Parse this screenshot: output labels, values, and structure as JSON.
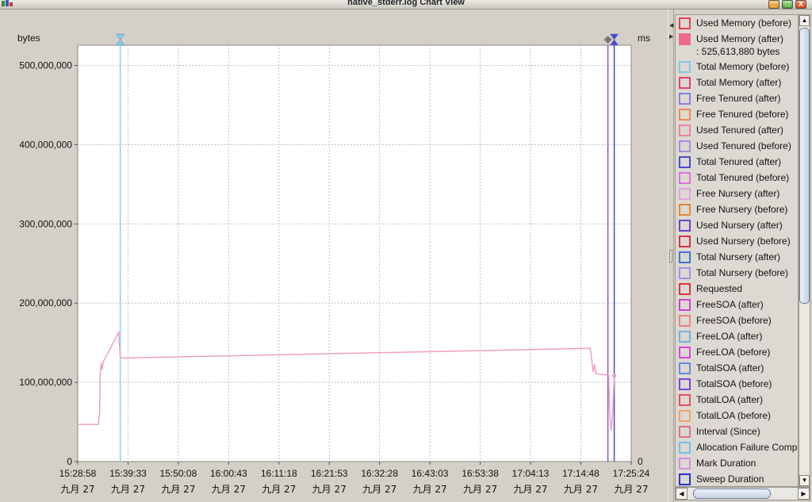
{
  "window": {
    "title": "native_stderr.log Chart View",
    "min_symbol": "_",
    "max_symbol": "□",
    "close_symbol": "X"
  },
  "colors": {
    "series_pink": "#f0a0c0",
    "marker_cyan": "#80d4ec",
    "marker_purple": "#9a50c8",
    "marker_blue": "#4a4ad0",
    "grid": "#c0c0c0",
    "plot_bg": "#ffffff"
  },
  "chart_data": {
    "type": "line",
    "title": "",
    "ylabel": "bytes",
    "y2label": "ms",
    "ylim": [
      0,
      525613880
    ],
    "y_ticks": [
      0,
      100000000,
      200000000,
      300000000,
      400000000,
      500000000
    ],
    "y_tick_labels": [
      "0",
      "100,000,000",
      "200,000,000",
      "300,000,000",
      "400,000,000",
      "500,000,000"
    ],
    "y2_tick_labels": [
      "0"
    ],
    "x_ticks": [
      {
        "time": "15:28:58",
        "date": "九月 27"
      },
      {
        "time": "15:39:33",
        "date": "九月 27"
      },
      {
        "time": "15:50:08",
        "date": "九月 27"
      },
      {
        "time": "16:00:43",
        "date": "九月 27"
      },
      {
        "time": "16:11:18",
        "date": "九月 27"
      },
      {
        "time": "16:21:53",
        "date": "九月 27"
      },
      {
        "time": "16:32:28",
        "date": "九月 27"
      },
      {
        "time": "16:43:03",
        "date": "九月 27"
      },
      {
        "time": "16:53:38",
        "date": "九月 27"
      },
      {
        "time": "17:04:13",
        "date": "九月 27"
      },
      {
        "time": "17:14:48",
        "date": "九月 27"
      },
      {
        "time": "17:25:24",
        "date": "九月 27"
      }
    ],
    "xlim": [
      "15:28:58",
      "17:25:24"
    ],
    "grid": true,
    "legend_position": "right",
    "series": [
      {
        "name": "Used Memory (after)",
        "color": "#f0a0c0",
        "points": [
          [
            "15:28:58",
            47000000
          ],
          [
            "15:33:20",
            47000000
          ],
          [
            "15:33:25",
            55000000
          ],
          [
            "15:33:35",
            61000000
          ],
          [
            "15:33:40",
            110000000
          ],
          [
            "15:33:55",
            124000000
          ],
          [
            "15:34:05",
            116000000
          ],
          [
            "15:34:20",
            126000000
          ],
          [
            "15:37:35",
            163000000
          ],
          [
            "15:37:55",
            131000000
          ],
          [
            "15:40:30",
            131000000
          ],
          [
            "17:16:48",
            143000000
          ],
          [
            "17:17:25",
            113000000
          ],
          [
            "17:17:40",
            123000000
          ],
          [
            "17:18:00",
            111000000
          ],
          [
            "17:20:40",
            109000000
          ],
          [
            "17:20:50",
            70000000
          ],
          [
            "17:21:10",
            39000000
          ],
          [
            "17:21:30",
            60000000
          ],
          [
            "17:21:50",
            108000000
          ]
        ]
      }
    ],
    "markers": [
      {
        "time": "15:37:55",
        "color": "#80d4ec",
        "icon": "hourglass-icon"
      },
      {
        "time": "17:20:30",
        "color": "#9a50c8",
        "icon": "diamond-icon"
      },
      {
        "time": "17:21:50",
        "color": "#4a4ad0",
        "icon": "hourglass-icon"
      }
    ]
  },
  "legend": {
    "items": [
      {
        "label": "Used Memory (before)",
        "color": "#e04050",
        "filled": false
      },
      {
        "label": "Used Memory (after)",
        "color": "#f06a90",
        "filled": true,
        "value": ": 525,613,880 bytes"
      },
      {
        "label": "Total Memory (before)",
        "color": "#80c8e8",
        "filled": false
      },
      {
        "label": "Total Memory (after)",
        "color": "#e04070",
        "filled": false
      },
      {
        "label": "Free Tenured (after)",
        "color": "#8a7ee0",
        "filled": false
      },
      {
        "label": "Free Tenured (before)",
        "color": "#f08a50",
        "filled": false
      },
      {
        "label": "Used Tenured (after)",
        "color": "#f080a0",
        "filled": false
      },
      {
        "label": "Used Tenured (before)",
        "color": "#a888e0",
        "filled": false
      },
      {
        "label": "Total Tenured (after)",
        "color": "#4a4ad0",
        "filled": false
      },
      {
        "label": "Total Tenured (before)",
        "color": "#e070e0",
        "filled": false
      },
      {
        "label": "Free Nursery (after)",
        "color": "#e0a0e0",
        "filled": false
      },
      {
        "label": "Free Nursery (before)",
        "color": "#e08838",
        "filled": false
      },
      {
        "label": "Used Nursery (after)",
        "color": "#7040d0",
        "filled": false
      },
      {
        "label": "Used Nursery (before)",
        "color": "#d83048",
        "filled": false
      },
      {
        "label": "Total Nursery (after)",
        "color": "#4070e0",
        "filled": false
      },
      {
        "label": "Total Nursery (before)",
        "color": "#a090e8",
        "filled": false
      },
      {
        "label": "Requested",
        "color": "#e03040",
        "filled": false
      },
      {
        "label": "FreeSOA (after)",
        "color": "#d040d0",
        "filled": false
      },
      {
        "label": "FreeSOA (before)",
        "color": "#f08080",
        "filled": false
      },
      {
        "label": "FreeLOA (after)",
        "color": "#70b0e0",
        "filled": false
      },
      {
        "label": "FreeLOA (before)",
        "color": "#e040e0",
        "filled": false
      },
      {
        "label": "TotalSOA (after)",
        "color": "#6090e0",
        "filled": false
      },
      {
        "label": "TotalSOA (before)",
        "color": "#8040e0",
        "filled": false
      },
      {
        "label": "TotalLOA (after)",
        "color": "#e05060",
        "filled": false
      },
      {
        "label": "TotalLOA (before)",
        "color": "#f0a070",
        "filled": false
      },
      {
        "label": "Interval (Since)",
        "color": "#e07090",
        "filled": false
      },
      {
        "label": "Allocation Failure Comp",
        "color": "#70c0e8",
        "filled": false
      },
      {
        "label": "Mark Duration",
        "color": "#d090e0",
        "filled": false
      },
      {
        "label": "Sweep Duration",
        "color": "#3030d0",
        "filled": false
      }
    ]
  },
  "scrollbars": {
    "up_arrow": "▲",
    "down_arrow": "▼",
    "left_arrow": "◀",
    "right_arrow": "▶"
  }
}
